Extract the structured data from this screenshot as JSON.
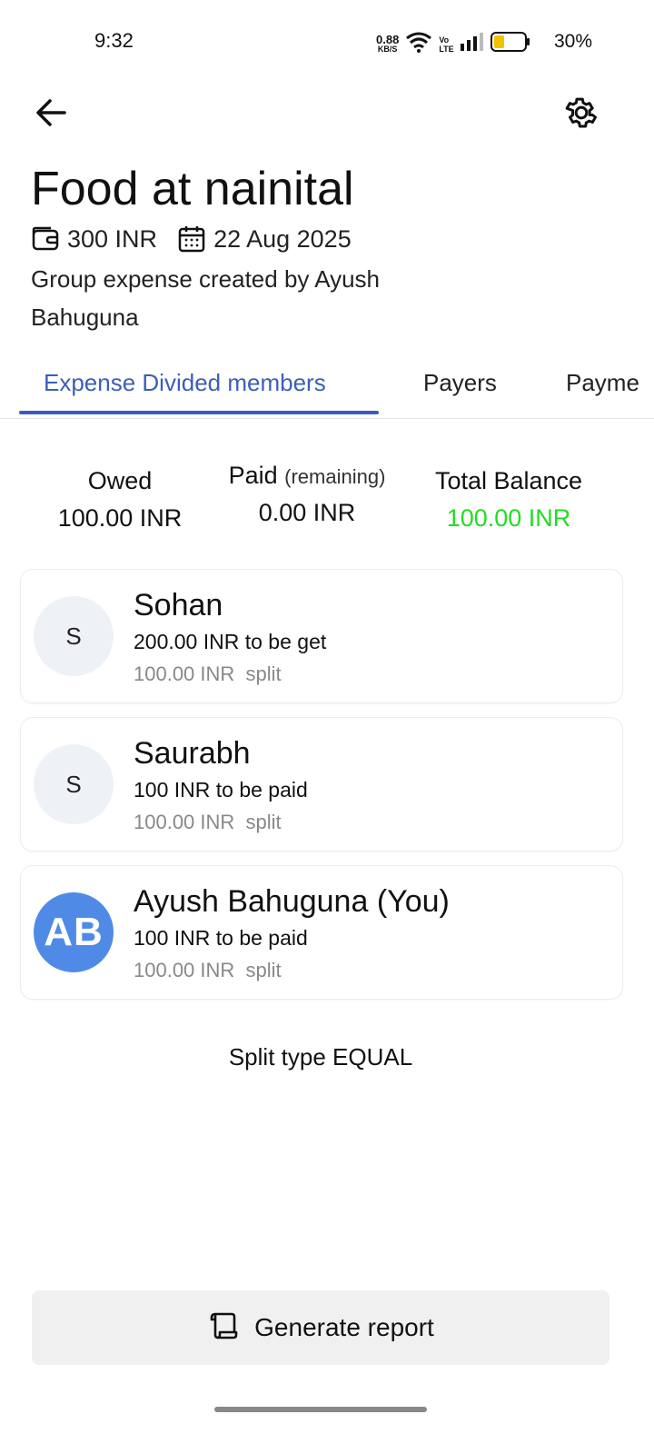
{
  "status_bar": {
    "time": "9:32",
    "net_speed": "0.88",
    "net_unit": "KB/S",
    "volte_top": "Vo",
    "volte_bottom": "LTE",
    "battery": "30%"
  },
  "header": {
    "back_icon": "arrow-left-icon",
    "settings_icon": "gear-icon"
  },
  "expense": {
    "title": "Food at nainital",
    "amount": "300 INR",
    "date": "22 Aug 2025",
    "created_by": "Group expense created by Ayush Bahuguna"
  },
  "tabs": [
    {
      "label": "Expense Divided members",
      "active": true
    },
    {
      "label": "Payers"
    },
    {
      "label": "Payme"
    }
  ],
  "summary": {
    "owed_label": "Owed",
    "owed_value": "100.00 INR",
    "paid_label": "Paid",
    "paid_sub": "(remaining)",
    "paid_value": "0.00 INR",
    "balance_label": "Total Balance",
    "balance_value": "100.00 INR",
    "balance_color": "#22dd22"
  },
  "members": [
    {
      "initials": "S",
      "name": "Sohan",
      "status": "200.00 INR to be get",
      "split_amount": "100.00 INR",
      "split_word": "split"
    },
    {
      "initials": "S",
      "name": "Saurabh",
      "status": "100 INR to be paid",
      "split_amount": "100.00 INR",
      "split_word": "split"
    },
    {
      "initials": "AB",
      "name": "Ayush Bahuguna (You)",
      "status": "100 INR to be paid",
      "split_amount": "100.00 INR",
      "split_word": "split",
      "avatar_color": "#4f8be6"
    }
  ],
  "split_type": "Split type EQUAL",
  "report_button": "Generate report",
  "accent_color": "#3a5cc0"
}
